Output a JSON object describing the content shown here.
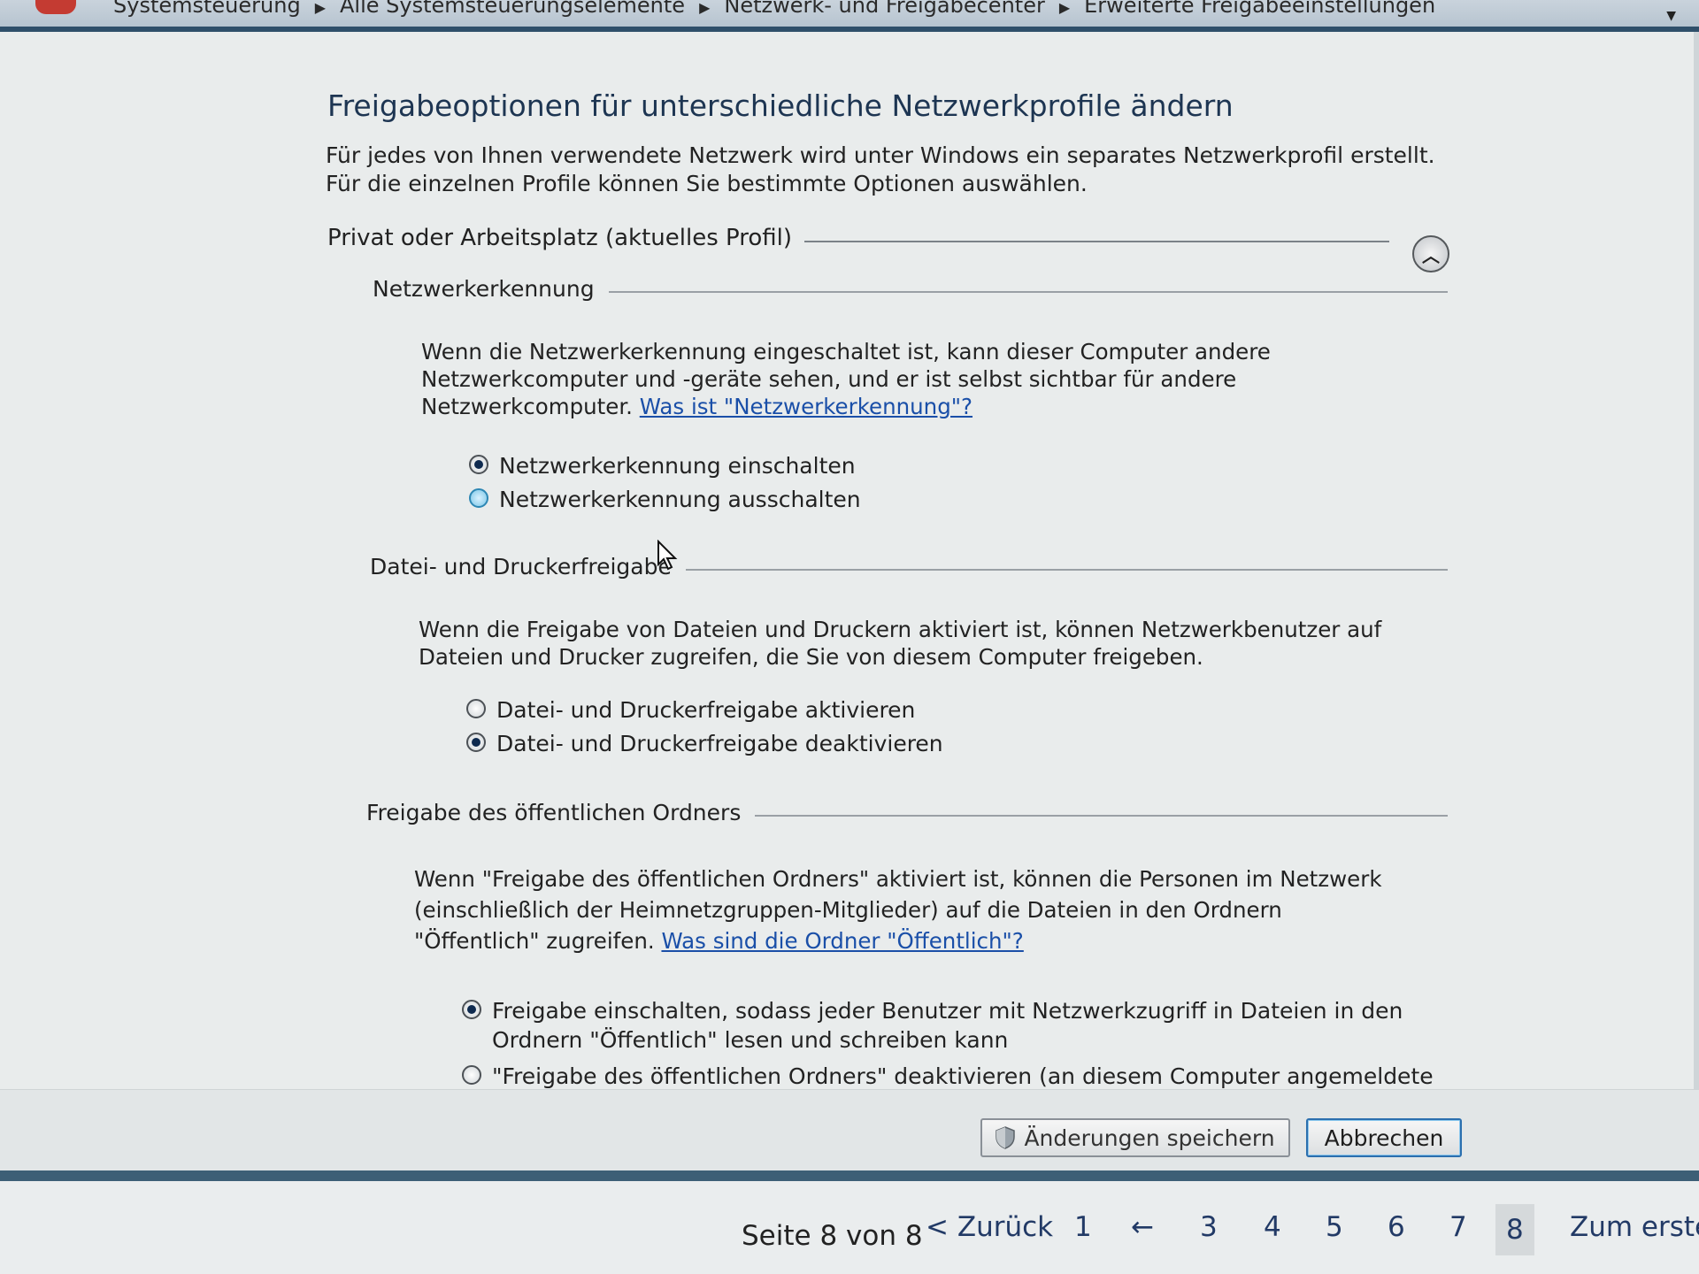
{
  "address_bar": {
    "crumbs": [
      "Systemsteuerung",
      "Alle Systemsteuerungselemente",
      "Netzwerk- und Freigabecenter",
      "Erweiterte Freigabeeinstellungen"
    ]
  },
  "page": {
    "title": "Freigabeoptionen für unterschiedliche Netzwerkprofile ändern",
    "intro": "Für jedes von Ihnen verwendete Netzwerk wird unter Windows ein separates Netzwerkprofil erstellt. Für die einzelnen Profile können Sie bestimmte Optionen auswählen."
  },
  "profile": {
    "label": "Privat oder Arbeitsplatz (aktuelles Profil)"
  },
  "network_discovery": {
    "heading": "Netzwerkerkennung",
    "desc": "Wenn die Netzwerkerkennung eingeschaltet ist, kann dieser Computer andere Netzwerkcomputer und -geräte sehen, und er ist selbst sichtbar für andere Netzwerkcomputer. ",
    "link": "Was ist \"Netzwerkerkennung\"?",
    "option_on": "Netzwerkerkennung einschalten",
    "option_off": "Netzwerkerkennung ausschalten"
  },
  "file_printer": {
    "heading": "Datei- und Druckerfreigabe",
    "desc": "Wenn die Freigabe von Dateien und Druckern aktiviert ist, können Netzwerkbenutzer auf Dateien und Drucker zugreifen, die Sie von diesem Computer freigeben.",
    "option_on": "Datei- und Druckerfreigabe aktivieren",
    "option_off": "Datei- und Druckerfreigabe deaktivieren"
  },
  "public_folder": {
    "heading": "Freigabe des öffentlichen Ordners",
    "desc": "Wenn \"Freigabe des öffentlichen Ordners\" aktiviert ist, können die Personen im Netzwerk (einschließlich der Heimnetzgruppen-Mitglieder) auf die Dateien in den Ordnern \"Öffentlich\" zugreifen. ",
    "link": "Was sind die Ordner \"Öffentlich\"?",
    "option_on": "Freigabe einschalten, sodass jeder Benutzer mit Netzwerkzugriff in Dateien in den Ordnern \"Öffentlich\" lesen und schreiben kann",
    "option_off": "\"Freigabe des öffentlichen Ordners\" deaktivieren (an diesem Computer angemeldete Benutzer können weiterhin auf diese Ordner zugreifen)"
  },
  "buttons": {
    "save": "Änderungen speichern",
    "cancel": "Abbrechen"
  },
  "pagination": {
    "label": "Seite 8 von 8",
    "back": "< Zurück",
    "pages": [
      "1",
      "←",
      "3",
      "4",
      "5",
      "6",
      "7",
      "8"
    ],
    "first": "Zum ersten"
  },
  "colors": {
    "link": "#1a4fa8",
    "title": "#1d3552",
    "default_button_border": "#2b6fae"
  }
}
